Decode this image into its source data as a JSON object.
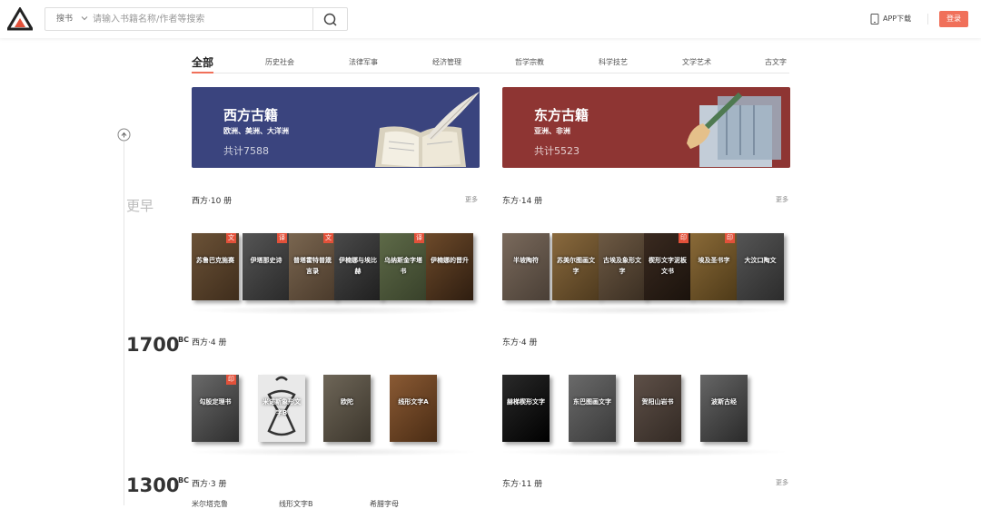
{
  "header": {
    "search_type": "搜书",
    "search_placeholder": "请输入书籍名称/作者等搜索",
    "app_download": "APP下载",
    "login": "登录"
  },
  "tabs": [
    "全部",
    "历史社会",
    "法律军事",
    "经济管理",
    "哲学宗教",
    "科学技艺",
    "文学艺术",
    "古文字"
  ],
  "timeline": {
    "early": "更早",
    "eras": [
      {
        "year": "1700",
        "suffix": "BC"
      },
      {
        "year": "1300",
        "suffix": "BC"
      }
    ]
  },
  "banners": [
    {
      "title": "西方古籍",
      "subtitle": "欧洲、美洲、大洋洲",
      "count": "共计7588",
      "color": "#3a447e"
    },
    {
      "title": "东方古籍",
      "subtitle": "亚洲、非洲",
      "count": "共计5523",
      "color": "#8e3533"
    }
  ],
  "sections": [
    {
      "title": "西方·10 册",
      "more": "更多",
      "books": [
        {
          "title": "苏鲁巴克施赛",
          "badge": "文"
        },
        {
          "title": "伊塔那史诗",
          "badge": "译"
        },
        {
          "title": "普塔霍特普箴言录",
          "badge": "文"
        },
        {
          "title": "伊楠娜与埃比赫",
          "badge": ""
        },
        {
          "title": "乌纳斯金字塔书",
          "badge": "译"
        },
        {
          "title": "伊楠娜的晋升",
          "badge": ""
        }
      ]
    },
    {
      "title": "东方·14 册",
      "more": "更多",
      "books": [
        {
          "title": "半坡陶符",
          "badge": ""
        },
        {
          "title": "苏美尔图画文字",
          "badge": ""
        },
        {
          "title": "古埃及象形文字",
          "badge": ""
        },
        {
          "title": "楔形文字泥板文书",
          "badge": "印"
        },
        {
          "title": "埃及圣书字",
          "badge": "印"
        },
        {
          "title": "大汶口陶文",
          "badge": ""
        }
      ]
    },
    {
      "title": "西方·4 册",
      "more": "",
      "books": [
        {
          "title": "勾股定理书",
          "badge": "印"
        },
        {
          "title": "米诺斯象形文字B",
          "badge": ""
        },
        {
          "title": "欧陀",
          "badge": ""
        },
        {
          "title": "线形文字A",
          "badge": ""
        }
      ]
    },
    {
      "title": "东方·4 册",
      "more": "",
      "books": [
        {
          "title": "赫梯楔形文字",
          "badge": ""
        },
        {
          "title": "东巴图画文字",
          "badge": ""
        },
        {
          "title": "贺阳山岩书",
          "badge": ""
        },
        {
          "title": "波斯古经",
          "badge": ""
        }
      ]
    },
    {
      "title": "西方·3 册",
      "more": ""
    },
    {
      "title": "东方·11 册",
      "more": "更多"
    }
  ],
  "footer_fragments": [
    "米尔塔克鲁",
    "线形文字B",
    "希腊字母"
  ],
  "colors": {
    "accent": "#f0705a",
    "badge": "#e2513a"
  }
}
